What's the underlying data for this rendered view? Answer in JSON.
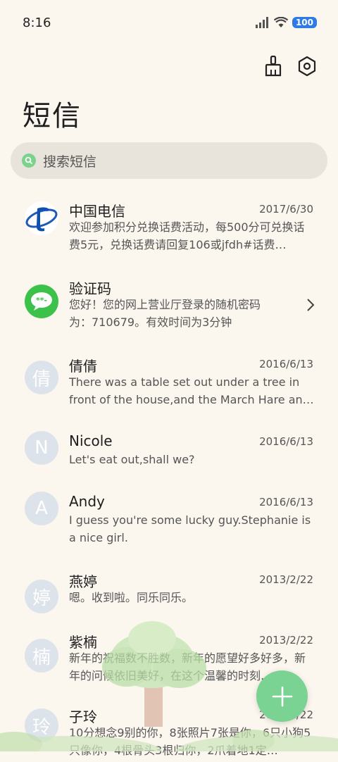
{
  "status_bar": {
    "time": "8:16",
    "battery": "100"
  },
  "header": {
    "title": "短信",
    "clean_icon": "broom-icon",
    "settings_icon": "settings-icon"
  },
  "search": {
    "placeholder": "搜索短信"
  },
  "conversations": [
    {
      "name": "中国电信",
      "date": "2017/6/30",
      "preview": "欢迎参加积分兑换话费活动，每500分可兑换话费5元，兑换话费请回复106或jfdh#话费…",
      "avatar": "china-telecom-logo"
    },
    {
      "name": "验证码",
      "date": "",
      "preview": "您好！您的网上营业厅登录的随机密码为：710679。有效时间为3分钟",
      "avatar": "message-bubble-icon"
    },
    {
      "name": "倩倩",
      "date": "2016/6/13",
      "preview": "There was a table set out under a tree in front of the house,and the March Hare an…",
      "avatar_letter": "倩"
    },
    {
      "name": "Nicole",
      "date": "2016/6/13",
      "preview": "Let's eat out,shall we?",
      "avatar_letter": "N"
    },
    {
      "name": "Andy",
      "date": "2016/6/13",
      "preview": "I guess you're some lucky guy.Stephanie is a nice girl.",
      "avatar_letter": "A"
    },
    {
      "name": "燕婷",
      "date": "2013/2/22",
      "preview": "嗯。收到啦。同乐同乐。",
      "avatar_letter": "婷"
    },
    {
      "name": "紫楠",
      "date": "2013/2/22",
      "preview": "新年的祝福数不胜数，新年的愿望好多好多，新年的问候依旧美好，在这个温馨的时刻…",
      "avatar_letter": "楠"
    },
    {
      "name": "子玲",
      "date": "2013/2/22",
      "preview": "10分想念9别的你，8张照片7张是你，6只小狗5只像你，4根骨头3根归你，2爪着地1定…",
      "avatar_letter": "玲"
    }
  ],
  "fab": {
    "icon": "plus-icon"
  }
}
